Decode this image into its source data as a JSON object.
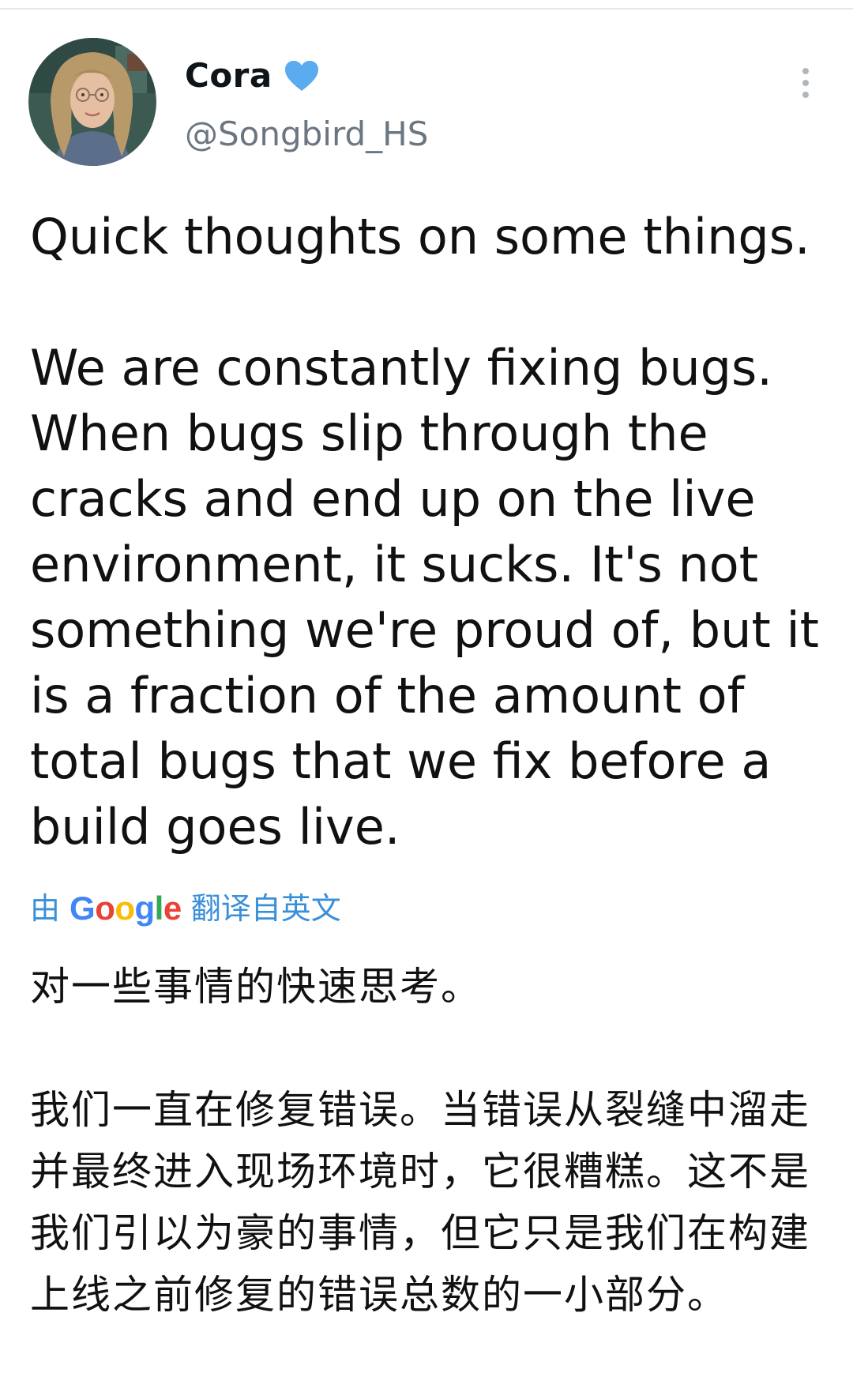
{
  "tweet": {
    "author": {
      "display_name": "Cora",
      "handle": "@Songbird_HS",
      "verified": true,
      "verified_color": "#5aabef",
      "avatar_icon": "user-avatar-photo"
    },
    "menu_icon": "more-vertical-icon",
    "text": "Quick thoughts on some things.\n\nWe are constantly fixing bugs. When bugs slip through the cracks and end up on the live environment, it sucks. It's not something we're proud of, but it is a fraction of the amount of total bugs that we fix before a build goes live.",
    "translation": {
      "prefix": "由",
      "provider": "Google",
      "suffix": "翻译自英文",
      "link_color": "#3a8fd9",
      "text": "对一些事情的快速思考。\n\n我们一直在修复错误。当错误从裂缝中溜走并最终进入现场环境时，它很糟糕。这不是我们引以为豪的事情，但它只是我们在构建上线之前修复的错误总数的一小部分。"
    }
  }
}
